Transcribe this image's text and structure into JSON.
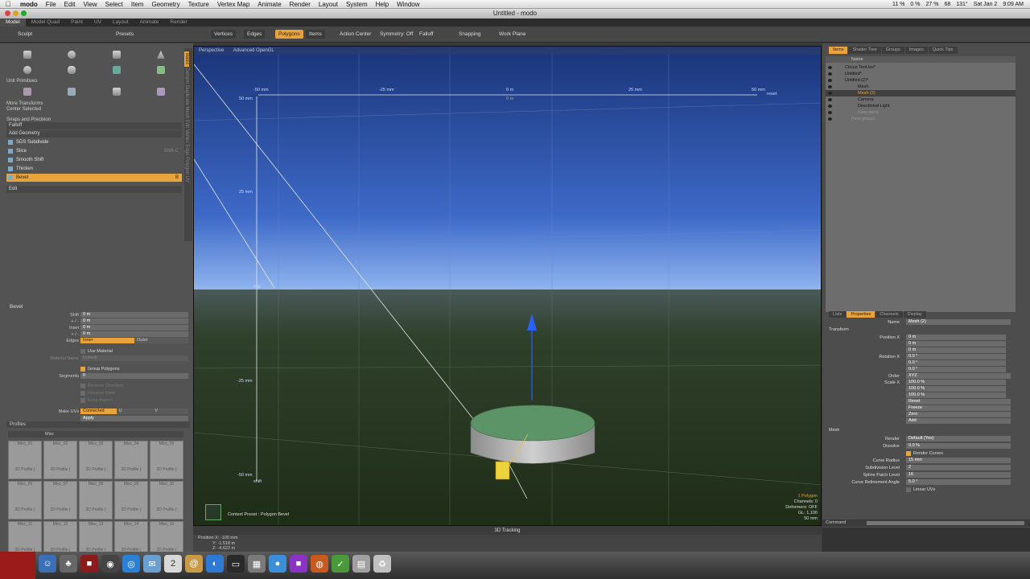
{
  "menubar": {
    "app": "modo",
    "items": [
      "File",
      "Edit",
      "View",
      "Select",
      "Item",
      "Geometry",
      "Texture",
      "Vertex Map",
      "Animate",
      "Render",
      "Layout",
      "System",
      "Help",
      "Window"
    ],
    "status": [
      "11 %",
      "0 %",
      "27 %",
      "68",
      "131°",
      "Sat Jan 2",
      "9:09 AM"
    ]
  },
  "window_title": "Untitled - modo",
  "layout_tabs": [
    "Model",
    "Model Quad",
    "Paint",
    "UV",
    "Layout",
    "Animate",
    "Render"
  ],
  "toolbar": {
    "sculpt": "Sculpt",
    "presets": "Presets",
    "vertices": "Vertices",
    "edges": "Edges",
    "polygons": "Polygons",
    "items": "Items",
    "action_center": "Action Center",
    "symmetry": "Symmetry: Off",
    "falloff": "Falloff",
    "snapping": "Snapping",
    "work_plane": "Work Plane"
  },
  "left_tabs": [
    "Basic",
    "Deform",
    "Duplicate",
    "Mesh Edit",
    "Vertex",
    "Edge",
    "Polygon",
    "UV"
  ],
  "left_panel": {
    "unit_primitives": "Unit Primitives",
    "more_transforms": "More Transforms",
    "center_selected": "Center Selected",
    "snaps_precision": "Snaps and Precision",
    "falloff": "Falloff",
    "add_geometry": "Add Geometry",
    "tools": [
      {
        "label": "SDS Subdivide",
        "shortcut": ""
      },
      {
        "label": "Slice",
        "shortcut": "Shift-C"
      },
      {
        "label": "Smooth Shift",
        "shortcut": ""
      },
      {
        "label": "Thicken",
        "shortcut": ""
      },
      {
        "label": "Bevel",
        "shortcut": "B"
      }
    ],
    "edit": "Edit"
  },
  "bevel": {
    "title": "Bevel",
    "rows": [
      {
        "label": "Shift",
        "value": "0 m"
      },
      {
        "label": "+ / -",
        "value": "0 m"
      },
      {
        "label": "Inset",
        "value": "0 m"
      },
      {
        "label": "+ / -",
        "value": "0 m"
      }
    ],
    "edges_label": "Edges",
    "edges_options": [
      "Inner",
      "Outer"
    ],
    "use_material": "Use Material",
    "material_name_label": "Material Name",
    "material_name_value": "Default",
    "group_polygons": "Group Polygons",
    "segments_label": "Segments",
    "segments_value": "0",
    "reverse_direction": "Reverse Direction",
    "reverse_inset": "Reverse Inset",
    "keep_aspect": "Keep Aspect",
    "make_uvs_label": "Make UVs",
    "make_uvs_options": [
      "Connected",
      "U",
      "V"
    ],
    "apply": "Apply"
  },
  "profiles": {
    "title": "Profiles",
    "category": "Misc",
    "cells": [
      "Misc_01",
      "Misc_02",
      "Misc_03",
      "Misc_04",
      "Misc_05",
      "Misc_06",
      "Misc_07",
      "Misc_08",
      "Misc_09",
      "Misc_10",
      "Misc_11",
      "Misc_12",
      "Misc_13",
      "Misc_14",
      "Misc_15"
    ],
    "caption": "2D Profile ("
  },
  "viewport": {
    "tabs": [
      "Perspective",
      "Advanced OpenGL"
    ],
    "ruler_top": [
      "-50 mm",
      "-25 mm",
      "0 m",
      "25 mm",
      "50 mm",
      "reset"
    ],
    "ruler_left": [
      "50 mm",
      "25 mm",
      "0 m",
      "-25 mm",
      "-50 mm"
    ],
    "ruler_left_extra": "shift",
    "ruler_center_top": "0 m",
    "preset_text": "Context Preset : Polygon Bevel",
    "info_orange": "1 Polygon",
    "info_lines": [
      "Channels: 0",
      "Deformers: OFF",
      "GL: 1,100",
      "50 mm"
    ],
    "status": "3D Tracking",
    "position_lines": [
      "Position X: -100 mm",
      "Y: -1.518 m",
      "Z: -4.622 m"
    ]
  },
  "items_panel": {
    "tabs": [
      "Items",
      "Shader Tree",
      "Groups",
      "Images",
      "Quick Tips"
    ],
    "header": "Name",
    "rows": [
      {
        "label": "Circus Tent.lxo*",
        "indent": 3
      },
      {
        "label": "Untitled*",
        "indent": 3
      },
      {
        "label": "Untitled (2)*",
        "indent": 3
      },
      {
        "label": "Mesh",
        "indent": 5
      },
      {
        "label": "Mesh (2)",
        "indent": 5,
        "selected": true
      },
      {
        "label": "Camera",
        "indent": 5
      },
      {
        "label": "Directional Light",
        "indent": 5
      },
      {
        "label": "(new item)",
        "indent": 5,
        "dim": true
      },
      {
        "label": "(new group)",
        "indent": 4,
        "dim": true
      }
    ]
  },
  "properties": {
    "tabs": [
      "Lists",
      "Properties",
      "Channels",
      "Display"
    ],
    "name_label": "Name",
    "name_value": "Mesh (2)",
    "transform": "Transform",
    "position_label": "Position X",
    "position": [
      "0 m",
      "0 m",
      "0 m"
    ],
    "rotation_label": "Rotation X",
    "rotation": [
      "0.0 °",
      "0.0 °",
      "0.0 °"
    ],
    "order_label": "Order",
    "order_value": "XYZ",
    "scale_label": "Scale X",
    "scale": [
      "100.0 %",
      "100.0 %",
      "100.0 %"
    ],
    "actions": [
      "Reset",
      "Freeze",
      "Zero",
      "Add"
    ],
    "mesh": "Mesh",
    "render_label": "Render",
    "render_value": "Default (Yes)",
    "dissolve_label": "Dissolve",
    "dissolve_value": "0.0 %",
    "render_curves": "Render Curves",
    "curve_radius_label": "Curve Radius",
    "curve_radius_value": "15 mm",
    "subdivision_label": "Subdivision Level",
    "subdivision_value": "2",
    "spline_label": "Spline Patch Level",
    "spline_value": "16",
    "curve_ref_label": "Curve Refinement Angle",
    "curve_ref_value": "5.0 °",
    "linear_uvs": "Linear UVs",
    "command": "Command"
  },
  "colors": {
    "accent": "#e9a33c",
    "sky_top": "#1c3c8a",
    "ground": "#27371f",
    "disk_top": "#5a8a62"
  }
}
